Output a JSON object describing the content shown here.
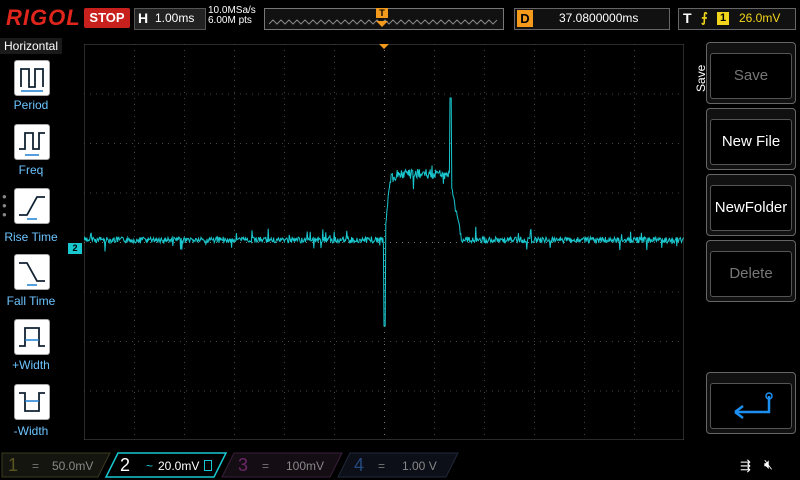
{
  "top": {
    "brand": "RIGOL",
    "run_state": "STOP",
    "horizontal_letter": "H",
    "timebase": "1.00ms",
    "sample_rate": "10.0MSa/s",
    "memory_depth": "6.00M pts",
    "delay_letter": "D",
    "delay": "37.0800000ms",
    "trigger_letter": "T",
    "trigger_source": "1",
    "trigger_level": "26.0mV"
  },
  "left_menu": {
    "title": "Horizontal",
    "items": [
      {
        "label": "Period",
        "icon": "period-icon"
      },
      {
        "label": "Freq",
        "icon": "freq-icon"
      },
      {
        "label": "Rise Time",
        "icon": "rise-time-icon"
      },
      {
        "label": "Fall Time",
        "icon": "fall-time-icon"
      },
      {
        "label": "+Width",
        "icon": "pos-width-icon"
      },
      {
        "label": "-Width",
        "icon": "neg-width-icon"
      }
    ]
  },
  "right_menu": {
    "title": "Save",
    "buttons": [
      {
        "label": "Save",
        "enabled": false
      },
      {
        "label": "New File",
        "enabled": true
      },
      {
        "label": "NewFolder",
        "enabled": true
      },
      {
        "label": "Delete",
        "enabled": false
      }
    ],
    "back_icon": "return-arrow-icon"
  },
  "channels": [
    {
      "num": "1",
      "coupling": "=",
      "scale": "50.0mV",
      "color": "#f3d51c",
      "active": false
    },
    {
      "num": "2",
      "coupling": "~",
      "scale": "20.0mV",
      "color": "#19c8cf",
      "active": true
    },
    {
      "num": "3",
      "coupling": "=",
      "scale": "100mV",
      "color": "#e23ad7",
      "active": false
    },
    {
      "num": "4",
      "coupling": "=",
      "scale": "1.00 V",
      "color": "#1a78e0",
      "active": false
    }
  ],
  "markers": {
    "trigger_marker": "T",
    "channel_marker": "2"
  },
  "status_icons": [
    "usb-icon",
    "mute-icon"
  ],
  "colors": {
    "accent_orange": "#f39a1c",
    "trace": "#19c8cf",
    "stop_red": "#c8201c"
  }
}
